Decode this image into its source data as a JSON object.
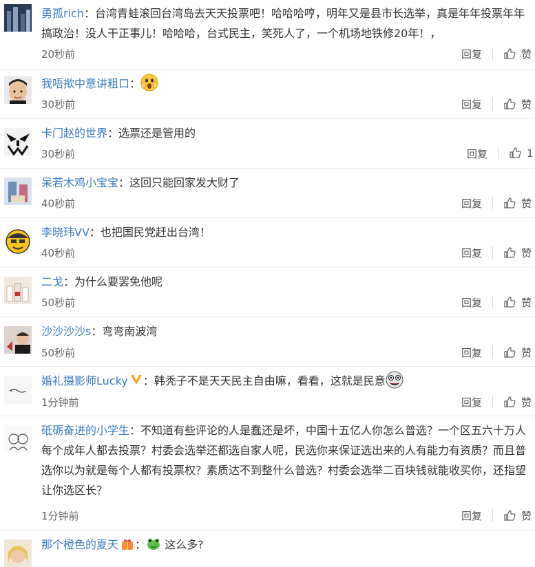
{
  "comments": [
    {
      "user": "勇孤rich",
      "text": "台湾青蛙滚回台湾岛去天天投票吧！哈哈哈哼，明年又是县市长选举，真是年年投票年年搞政治！没人干正事儿！哈哈哈，台式民主，笑死人了，一个机场地铁修20年！，",
      "time": "20秒前",
      "reply": "回复",
      "like": "赞"
    },
    {
      "user": "我唔揿中意讲粗口",
      "text": "",
      "emoji": "scared-face-emoji",
      "time": "30秒前",
      "reply": "回复",
      "like": "赞"
    },
    {
      "user": "卡门赵的世界",
      "text": "选票还是管用的",
      "time": "30秒前",
      "reply": "回复",
      "like": "1"
    },
    {
      "user": "呆若木鸡小宝宝",
      "text": "这回只能回家发大财了",
      "time": "40秒前",
      "reply": "回复",
      "like": "赞"
    },
    {
      "user": "李晓玮VV",
      "text": "也把国民党赶出台湾！",
      "time": "40秒前",
      "reply": "回复",
      "like": "赞"
    },
    {
      "user": "二戈",
      "text": "为什么要罢免他呢",
      "time": "50秒前",
      "reply": "回复",
      "like": "赞"
    },
    {
      "user": "沙沙沙沙s",
      "text": "弯弯南波湾",
      "time": "50秒前",
      "reply": "回复",
      "like": "赞"
    },
    {
      "user": "婚礼摄影师Lucky",
      "text": "韩秃子不是天天民主自由嘛，看看，这就是民意",
      "badge": "vip-v-badge",
      "emoji": "crazy-face-emoji",
      "time": "1分钟前",
      "reply": "回复",
      "like": "赞"
    },
    {
      "user": "砥砺奋进的小学生",
      "text": "不知道有些评论的人是蠢还是坏，中国十五亿人你怎么普选？一个区五六十万人每个成年人都去投票？村委会选举还都选自家人呢，民选你来保证选出来的人有能力有资质？而且普选你以为就是每个人都有投票权？素质达不到整什么普选？村委会选举二百块钱就能收买你，还指望让你选区长？",
      "time": "1分钟前",
      "reply": "回复",
      "like": "赞"
    },
    {
      "user": "那个橙色的夏天",
      "text": "这么多?",
      "badge": "gift-badge",
      "emoji": "frog-emoji",
      "time": "",
      "reply": "",
      "like": ""
    }
  ],
  "colors": {
    "link": "#3b7bc2",
    "meta": "#666666",
    "divider": "#ececec"
  }
}
